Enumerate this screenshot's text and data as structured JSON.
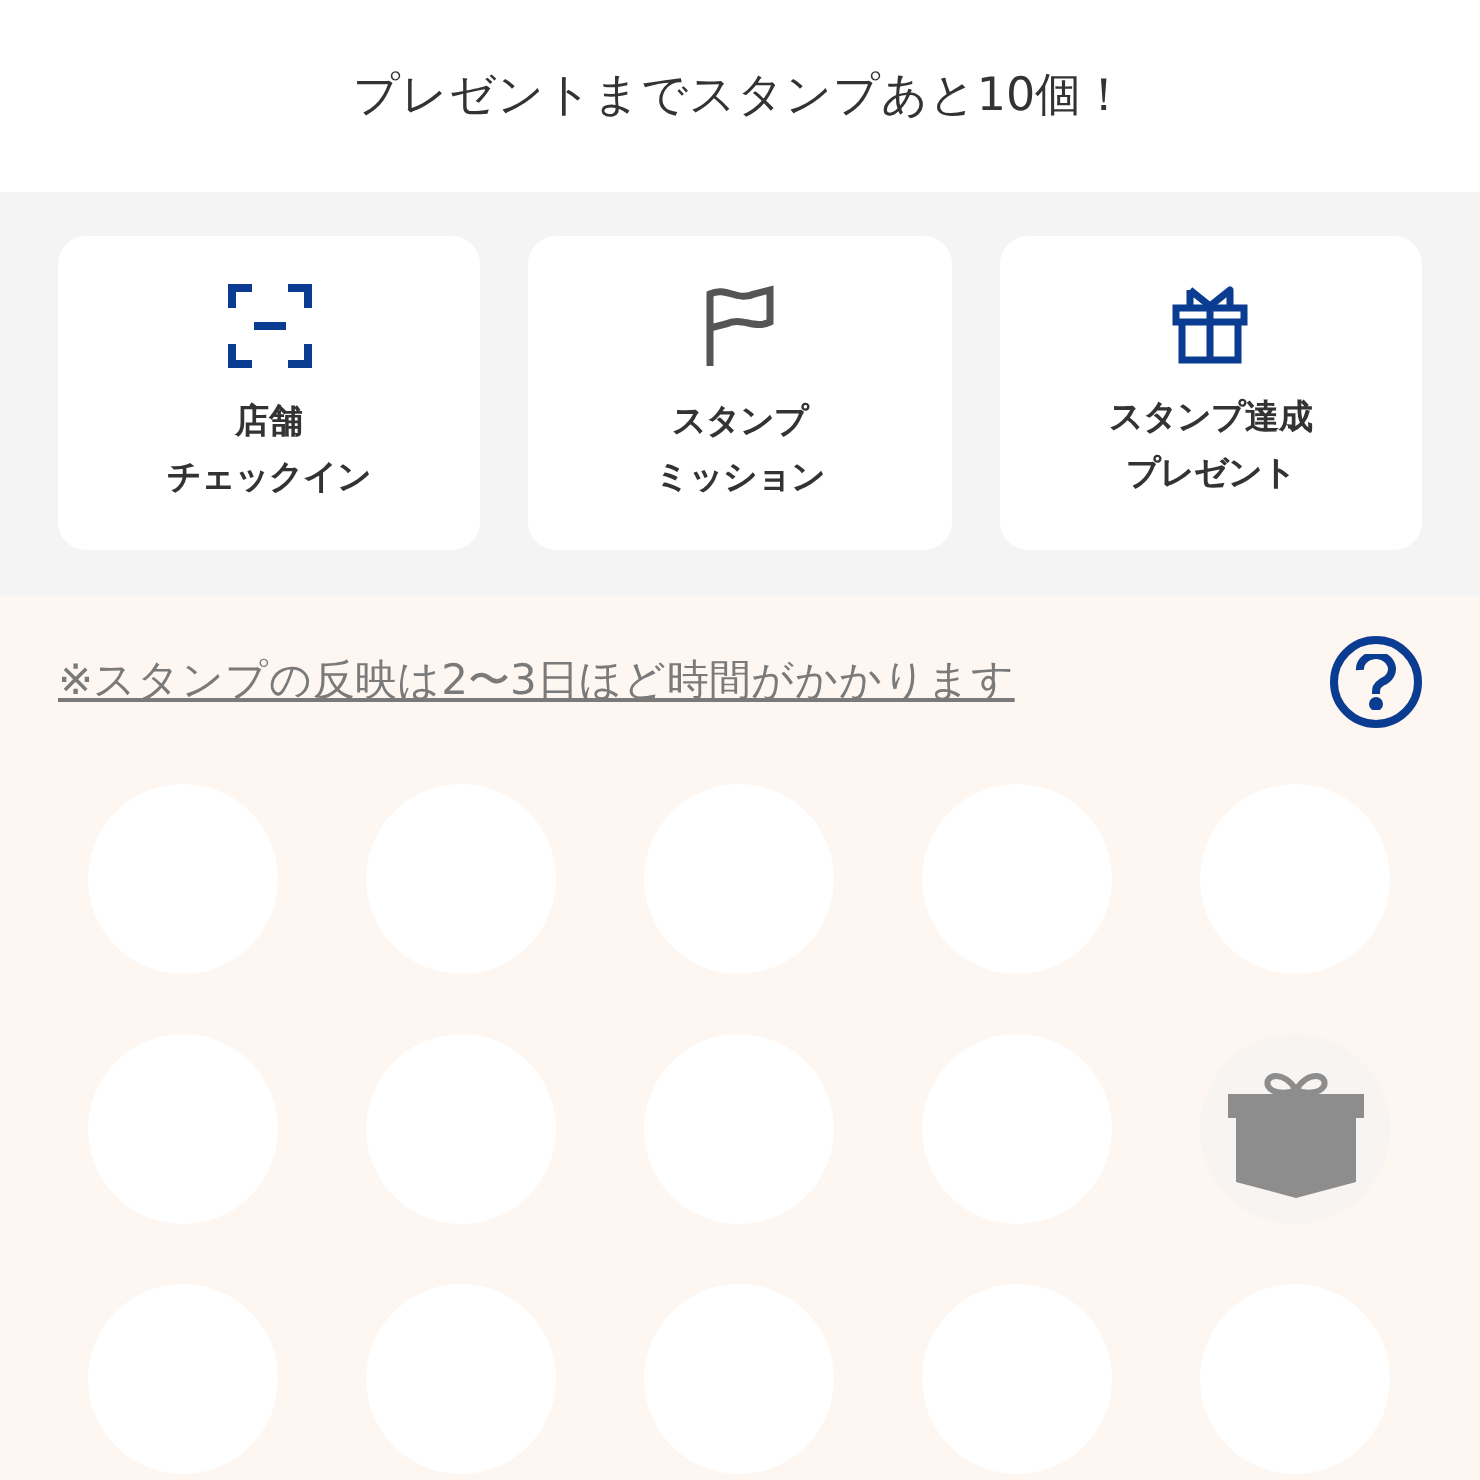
{
  "header": {
    "title": "プレゼントまでスタンプあと10個！"
  },
  "menu_cards": [
    {
      "kind": "checkin",
      "lines": [
        "店舗",
        "チェックイン"
      ]
    },
    {
      "kind": "mission",
      "lines": [
        "スタンプ",
        "ミッション"
      ]
    },
    {
      "kind": "present",
      "lines": [
        "スタンプ達成",
        "プレゼント"
      ]
    }
  ],
  "notice": {
    "text": "※スタンプの反映は2〜3日ほど時間がかかります"
  },
  "stamps": [
    {
      "kind": "empty"
    },
    {
      "kind": "empty"
    },
    {
      "kind": "empty"
    },
    {
      "kind": "empty"
    },
    {
      "kind": "empty"
    },
    {
      "kind": "empty"
    },
    {
      "kind": "empty"
    },
    {
      "kind": "empty"
    },
    {
      "kind": "empty"
    },
    {
      "kind": "gift"
    },
    {
      "kind": "empty"
    },
    {
      "kind": "empty"
    },
    {
      "kind": "empty"
    },
    {
      "kind": "empty"
    },
    {
      "kind": "empty"
    }
  ]
}
